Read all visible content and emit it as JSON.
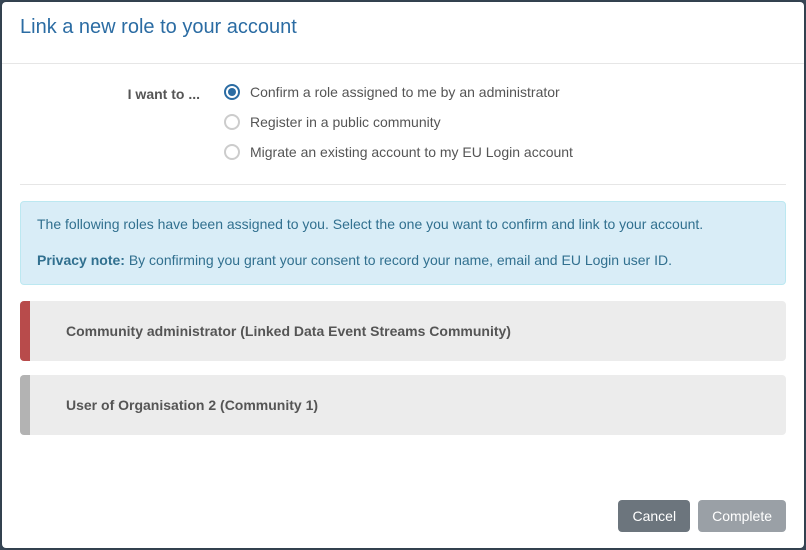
{
  "header": {
    "title": "Link a new role to your account"
  },
  "options": {
    "label": "I want to ...",
    "items": [
      {
        "label": "Confirm a role assigned to me by an administrator",
        "selected": true
      },
      {
        "label": "Register in a public community",
        "selected": false
      },
      {
        "label": "Migrate an existing account to my EU Login account",
        "selected": false
      }
    ]
  },
  "info": {
    "line1": "The following roles have been assigned to you. Select the one you want to confirm and link to your account.",
    "privacy_label": "Privacy note:",
    "privacy_text": " By confirming you grant your consent to record your name, email and EU Login user ID."
  },
  "roles": [
    {
      "label": "Community administrator (Linked Data Event Streams Community)",
      "accent": "red"
    },
    {
      "label": "User of Organisation 2 (Community 1)",
      "accent": "default"
    }
  ],
  "footer": {
    "cancel": "Cancel",
    "complete": "Complete"
  }
}
